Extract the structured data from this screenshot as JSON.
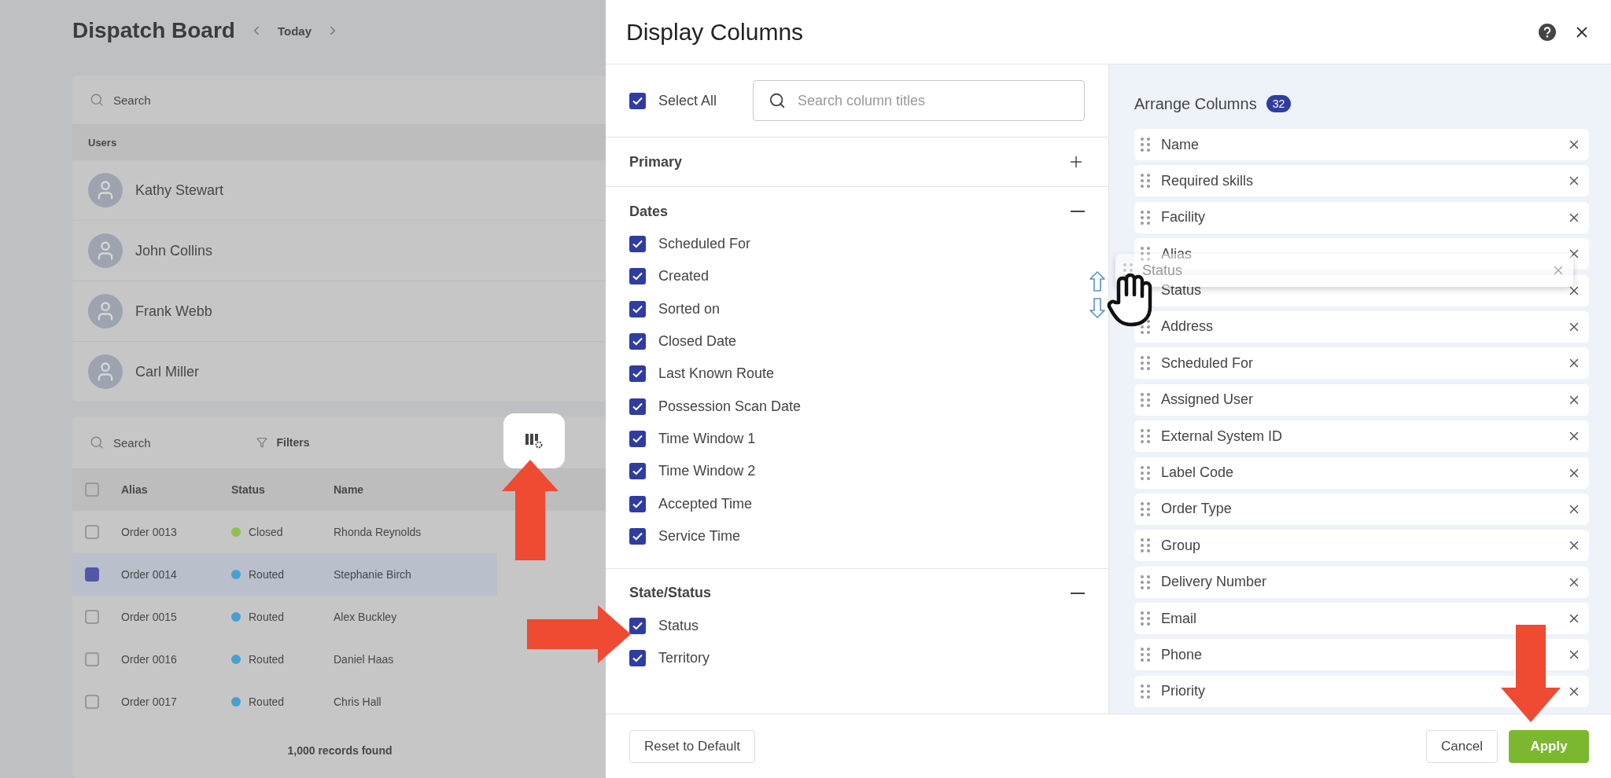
{
  "background": {
    "title": "Dispatch Board",
    "date": "Today",
    "search": {
      "placeholder": "Search"
    },
    "users_header": "Users",
    "users": [
      {
        "name": "Kathy Stewart"
      },
      {
        "name": "John Collins"
      },
      {
        "name": "Frank Webb"
      },
      {
        "name": "Carl Miller"
      }
    ],
    "orders": {
      "search": {
        "placeholder": "Search"
      },
      "filters": "Filters",
      "select_all_checked": false,
      "columns": [
        "Alias",
        "Status",
        "Name"
      ],
      "rows": [
        {
          "alias": "Order 0013",
          "status": "Closed",
          "color": "#8bc34a",
          "name": "Rhonda Reynolds",
          "selected": false
        },
        {
          "alias": "Order 0014",
          "status": "Routed",
          "color": "#4a9fd0",
          "name": "Stephanie Birch",
          "selected": true
        },
        {
          "alias": "Order 0015",
          "status": "Routed",
          "color": "#4a9fd0",
          "name": "Alex Buckley",
          "selected": false
        },
        {
          "alias": "Order 0016",
          "status": "Routed",
          "color": "#4a9fd0",
          "name": "Daniel Haas",
          "selected": false
        },
        {
          "alias": "Order 0017",
          "status": "Routed",
          "color": "#4a9fd0",
          "name": "Chris Hall",
          "selected": false
        }
      ],
      "footer": "1,000 records found"
    }
  },
  "dialog": {
    "title": "Display Columns",
    "select_all": {
      "label": "Select All",
      "checked": true
    },
    "search": {
      "placeholder": "Search column titles"
    },
    "sections": [
      {
        "title": "Primary",
        "expanded": false
      },
      {
        "title": "Dates",
        "expanded": true,
        "items": [
          {
            "label": "Scheduled For",
            "checked": true
          },
          {
            "label": "Created",
            "checked": true
          },
          {
            "label": "Sorted on",
            "checked": true
          },
          {
            "label": "Closed Date",
            "checked": true
          },
          {
            "label": "Last Known Route",
            "checked": true
          },
          {
            "label": "Possession Scan Date",
            "checked": true
          },
          {
            "label": "Time Window 1",
            "checked": true
          },
          {
            "label": "Time Window 2",
            "checked": true
          },
          {
            "label": "Accepted Time",
            "checked": true
          },
          {
            "label": "Service Time",
            "checked": true
          }
        ]
      },
      {
        "title": "State/Status",
        "expanded": true,
        "items": [
          {
            "label": "Status",
            "checked": true
          },
          {
            "label": "Territory",
            "checked": true
          }
        ]
      }
    ],
    "arrange": {
      "title": "Arrange Columns",
      "count": "32",
      "items": [
        {
          "label": "Name"
        },
        {
          "label": "Required skills"
        },
        {
          "label": "Facility"
        },
        {
          "label": "Alias"
        },
        {
          "label": "Status"
        },
        {
          "label": "Address"
        },
        {
          "label": "Scheduled For"
        },
        {
          "label": "Assigned User"
        },
        {
          "label": "External System ID"
        },
        {
          "label": "Label Code"
        },
        {
          "label": "Order Type"
        },
        {
          "label": "Group"
        },
        {
          "label": "Delivery Number"
        },
        {
          "label": "Email"
        },
        {
          "label": "Phone"
        },
        {
          "label": "Priority"
        }
      ],
      "dragging": {
        "label": "Status"
      }
    },
    "buttons": {
      "reset": "Reset to Default",
      "cancel": "Cancel",
      "apply": "Apply"
    }
  }
}
